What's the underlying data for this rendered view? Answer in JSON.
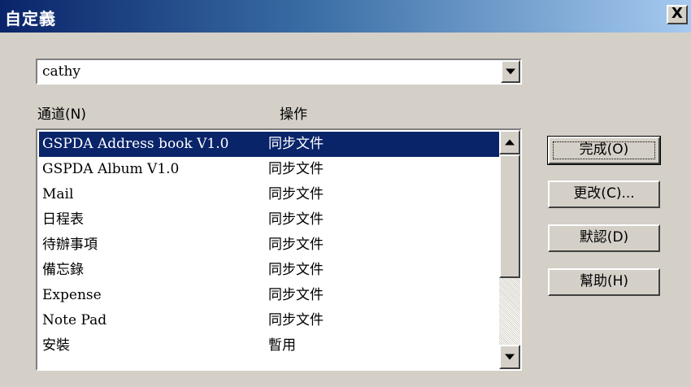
{
  "window": {
    "title": "自定義",
    "close_label": "X"
  },
  "user_combo": {
    "value": "cathy"
  },
  "list_headers": {
    "channel": "通道(N)",
    "action": "操作"
  },
  "conduits": [
    {
      "name": "GSPDA Address book V1.0",
      "action": "同步文件",
      "selected": true
    },
    {
      "name": "GSPDA Album V1.0",
      "action": "同步文件"
    },
    {
      "name": "Mail",
      "action": "同步文件"
    },
    {
      "name": "日程表",
      "action": "同步文件"
    },
    {
      "name": "待辦事項",
      "action": "同步文件"
    },
    {
      "name": "備忘錄",
      "action": "同步文件"
    },
    {
      "name": "Expense",
      "action": "同步文件"
    },
    {
      "name": "Note Pad",
      "action": "同步文件"
    },
    {
      "name": "安裝",
      "action": "暫用"
    }
  ],
  "buttons": {
    "done": "完成(O)",
    "change": "更改(C)...",
    "default": "默認(D)",
    "help": "幫助(H)"
  }
}
